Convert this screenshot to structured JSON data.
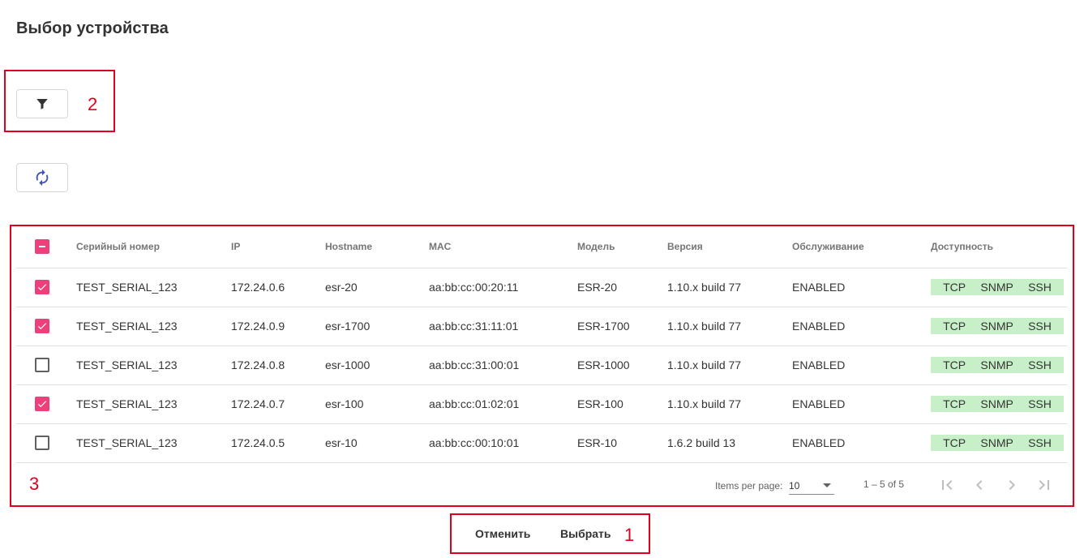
{
  "page": {
    "title": "Выбор устройства"
  },
  "annotations": {
    "actions": "1",
    "filter": "2",
    "table": "3"
  },
  "colors": {
    "checkbox_checked": "#ec407a",
    "availability_bg": "#c8f0c8",
    "annotation_red": "#e0001b",
    "refresh_icon": "#3f51b5"
  },
  "toolbar": {
    "filter_icon": "filter-icon",
    "refresh_icon": "refresh-icon"
  },
  "table": {
    "header_checkbox_state": "indeterminate",
    "columns": [
      "Серийный номер",
      "IP",
      "Hostname",
      "MAC",
      "Модель",
      "Версия",
      "Обслуживание",
      "Доступность"
    ],
    "rows": [
      {
        "checked": true,
        "serial": "TEST_SERIAL_123",
        "ip": "172.24.0.6",
        "hostname": "esr-20",
        "mac": "aa:bb:cc:00:20:11",
        "model": "ESR-20",
        "version": "1.10.x build 77",
        "service": "ENABLED",
        "availability": [
          "TCP",
          "SNMP",
          "SSH"
        ]
      },
      {
        "checked": true,
        "serial": "TEST_SERIAL_123",
        "ip": "172.24.0.9",
        "hostname": "esr-1700",
        "mac": "aa:bb:cc:31:11:01",
        "model": "ESR-1700",
        "version": "1.10.x build 77",
        "service": "ENABLED",
        "availability": [
          "TCP",
          "SNMP",
          "SSH"
        ]
      },
      {
        "checked": false,
        "serial": "TEST_SERIAL_123",
        "ip": "172.24.0.8",
        "hostname": "esr-1000",
        "mac": "aa:bb:cc:31:00:01",
        "model": "ESR-1000",
        "version": "1.10.x build 77",
        "service": "ENABLED",
        "availability": [
          "TCP",
          "SNMP",
          "SSH"
        ]
      },
      {
        "checked": true,
        "serial": "TEST_SERIAL_123",
        "ip": "172.24.0.7",
        "hostname": "esr-100",
        "mac": "aa:bb:cc:01:02:01",
        "model": "ESR-100",
        "version": "1.10.x build 77",
        "service": "ENABLED",
        "availability": [
          "TCP",
          "SNMP",
          "SSH"
        ]
      },
      {
        "checked": false,
        "serial": "TEST_SERIAL_123",
        "ip": "172.24.0.5",
        "hostname": "esr-10",
        "mac": "aa:bb:cc:00:10:01",
        "model": "ESR-10",
        "version": "1.6.2 build 13",
        "service": "ENABLED",
        "availability": [
          "TCP",
          "SNMP",
          "SSH"
        ]
      }
    ]
  },
  "paginator": {
    "items_per_page_label": "Items per page:",
    "page_size": "10",
    "range": "1 – 5 of 5"
  },
  "actions": {
    "cancel_label": "Отменить",
    "select_label": "Выбрать"
  }
}
